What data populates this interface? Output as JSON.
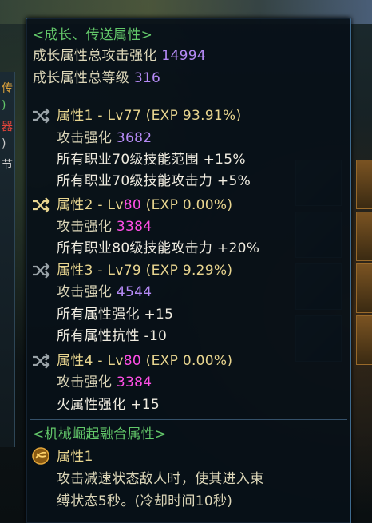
{
  "section_growth": {
    "title": "<成长、传送属性>",
    "total_attack": {
      "label": "成长属性总攻击强化",
      "value": "14994"
    },
    "total_level": {
      "label": "成长属性总等级",
      "value": "316"
    }
  },
  "attributes": [
    {
      "header_label": "属性1 - Lv",
      "level": "77",
      "exp": "(EXP 93.91%)",
      "attack_label": "攻击强化",
      "attack_value": "3682",
      "extras": [
        "所有职业70级技能范围 +15%",
        "所有职业70级技能攻击力 +5%"
      ]
    },
    {
      "header_label": "属性2 - Lv",
      "level": "80",
      "exp": "(EXP 0.00%)",
      "attack_label": "攻击强化",
      "attack_value": "3384",
      "extras": [
        "所有职业80级技能攻击力 +20%"
      ]
    },
    {
      "header_label": "属性3 - Lv",
      "level": "79",
      "exp": "(EXP 9.29%)",
      "attack_label": "攻击强化",
      "attack_value": "4544",
      "extras": [
        "所有属性强化 +15",
        "所有属性抗性 -10"
      ]
    },
    {
      "header_label": "属性4 - Lv",
      "level": "80",
      "exp": "(EXP 0.00%)",
      "attack_label": "攻击强化",
      "attack_value": "3384",
      "extras": [
        "火属性强化 +15"
      ]
    }
  ],
  "section_fusion": {
    "title": "<机械崛起融合属性>",
    "attr_label": "属性1",
    "desc_line1": "攻击减速状态敌人时，使其进入束",
    "desc_line2": "缚状态5秒。(冷却时间10秒)"
  },
  "background": {
    "left_panel_chars": [
      "传",
      ")",
      "器",
      ")",
      "节"
    ]
  },
  "colors": {
    "section_title": "#63c86a",
    "label": "#dcd6b8",
    "value_purple": "#b58af5",
    "value_magenta": "#ff4fe6",
    "header_gold": "#e8d58f",
    "border": "#3e6a8e"
  },
  "icons": {
    "attribute_header": "shuffle-icon",
    "fusion_attribute": "fusion-orb-icon"
  }
}
